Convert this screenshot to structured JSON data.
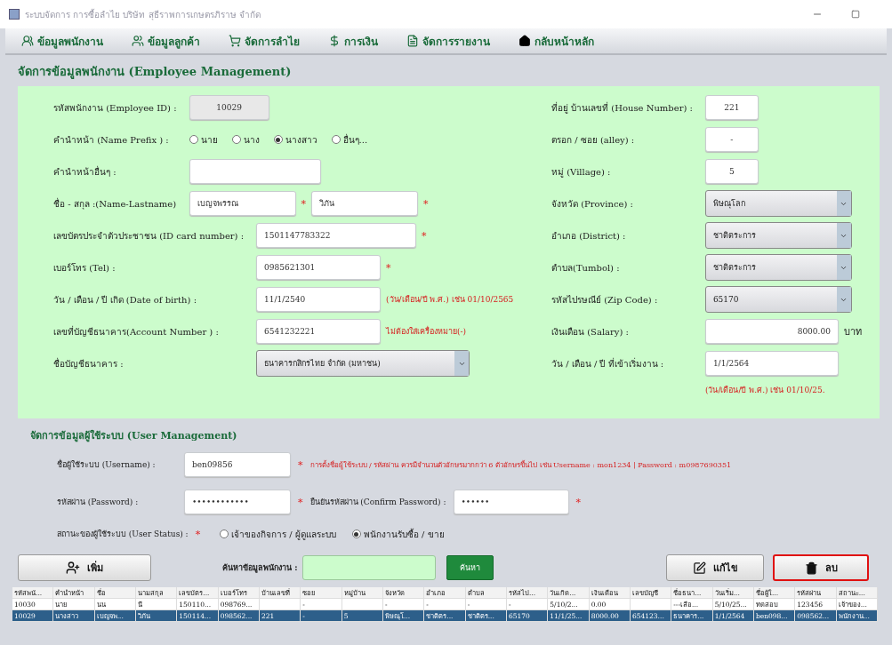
{
  "window": {
    "title": "ระบบจัดการ การซื้อลำไย บริษัท สุธีราพการเกษตรภิราษ จำกัด"
  },
  "menu": [
    {
      "label": "ข้อมูลพนักงาน"
    },
    {
      "label": "ข้อมูลลูกค้า"
    },
    {
      "label": "จัดการลำไย"
    },
    {
      "label": "การเงิน"
    },
    {
      "label": "จัดการรายงาน"
    },
    {
      "label": "กลับหน้าหลัก"
    }
  ],
  "section_title": "จัดการข้อมูลพนักงาน (Employee Management)",
  "employee_left": [
    {
      "kind": "readonly",
      "label": "รหัสพนักงาน (Employee ID) :",
      "value": "10029"
    },
    {
      "kind": "radio",
      "label": "คำนำหน้า (Name Prefix ) :",
      "options": [
        {
          "label": "นาย",
          "selected": false
        },
        {
          "label": "นาง",
          "selected": false
        },
        {
          "label": "นางสาว",
          "selected": true
        },
        {
          "label": "อื่นๆ...",
          "selected": false
        }
      ]
    },
    {
      "kind": "text",
      "label": "คำนำหน้าอื่นๆ  :"
    },
    {
      "kind": "name",
      "label": "ชื่อ - สกุล :(Name-Lastname)",
      "values": [
        "เบญจพรรณ",
        "วิภัน"
      ],
      "marks": [
        "*",
        "*"
      ]
    },
    {
      "kind": "text",
      "label": "เลขบัตรประจำตัวประชาชน (ID card number) :",
      "value": "1501147783322",
      "mark": "*"
    },
    {
      "kind": "text",
      "label": "เบอร์โทร (Tel) :",
      "value": "0985621301",
      "mark": "*"
    },
    {
      "kind": "text",
      "label": "วัน / เดือน / ปี เกิด (Date of birth) :",
      "value": "11/1/2540",
      "note": "(วัน/เดือน/ปี พ.ศ.) เช่น 01/10/2565"
    },
    {
      "kind": "text",
      "label": "เลขที่บัญชีธนาคาร(Account Number ) :",
      "value": "6541232221",
      "note": "ไม่ต้องใส่เครื่องหมาย(-)"
    },
    {
      "kind": "select",
      "label": "ชื่อบัญชีธนาคาร :",
      "value": "ธนาคารกสิกรไทย จำกัด (มหาชน)"
    }
  ],
  "employee_right": [
    {
      "kind": "short",
      "label": "ที่อยู่ บ้านเลขที่ (House Number) :",
      "value": "221"
    },
    {
      "kind": "short",
      "label": "ตรอก / ซอย (alley) :",
      "value": "-"
    },
    {
      "kind": "short",
      "label": "หมู่ (Village) :",
      "value": "5"
    },
    {
      "kind": "select",
      "label": "จังหวัด (Province) :",
      "value": "พิษณุโลก"
    },
    {
      "kind": "select",
      "label": "อำเภอ (District) :",
      "value": "ชาติตระการ"
    },
    {
      "kind": "select",
      "label": "ตำบล(Tumbol) :",
      "value": "ชาติตระการ"
    },
    {
      "kind": "select",
      "label": "รหัสไปรษณีย์ (Zip Code) :",
      "value": "65170"
    },
    {
      "kind": "money",
      "label": "เงินเดือน (Salary) :",
      "value": "8000.00",
      "unit": "บาท"
    },
    {
      "kind": "text",
      "label": "วัน / เดือน / ปี ที่เข้าเริ่มงาน  :",
      "value": "1/1/2564",
      "note": "(วัน/เดือน/ปี พ.ศ.) เช่น 01/10/25."
    }
  ],
  "user_section_title": "จัดการข้อมูลผู้ใช้ระบบ (User Management)",
  "username": {
    "label": "ชื่อผู้ใช้ระบบ (Username) :",
    "value": "ben09856",
    "mark": "*",
    "hint": "การตั้งชื่อผู้ใช้ระบบ / รหัสผ่าน ควรมีจำนวนตัวอักษรมากกว่า 6 ตัวอักษรขึ้นไป เช่น Username : mon1234 | Password : m0987690351"
  },
  "password": {
    "label": "รหัสผ่าน (Password) :",
    "value": "••••••••••••",
    "mark": "*",
    "confirm_label": "ยืนยันรหัสผ่าน (Confirm Password) :",
    "confirm_value": "••••••",
    "confirm_mark": "*"
  },
  "status": {
    "label": "สถานะของผู้ใช้ระบบ (User Status) :",
    "mark": "*",
    "options": [
      {
        "label": "เจ้าของกิจการ / ผู้ดูแลระบบ",
        "selected": false
      },
      {
        "label": "พนักงานรับซื้อ / ขาย",
        "selected": true
      }
    ]
  },
  "actions": {
    "add": "เพิ่ม",
    "search_label": "ค้นหาข้อมูลพนักงาน :",
    "search_button": "ค้นหา",
    "edit": "แก้ไข",
    "delete": "ลบ"
  },
  "table": {
    "columns": [
      "รหัสพนั...",
      "คำนำหน้า",
      "ชื่อ",
      "นามสกุล",
      "เลขบัตร...",
      "เบอร์โทร",
      "บ้านเลขที่",
      "ซอย",
      "หมู่บ้าน",
      "จังหวัด",
      "อำเภอ",
      "ตำบล",
      "รหัสไป...",
      "วันเกิด...",
      "เงินเดือน",
      "เลขบัญชี",
      "ชื่อธนา...",
      "วันเริ่ม...",
      "ชื่อผู้ใ...",
      "รหัสผ่าน",
      "สถานะ..."
    ],
    "rows": [
      {
        "selected": false,
        "cells": [
          "10030",
          "นาย",
          "นน",
          "นี",
          "150110...",
          "098769...",
          "",
          "-",
          "",
          "-",
          "-",
          "-",
          "-",
          "5/10/2...",
          "0.00",
          "",
          "---เลือ...",
          "5/10/25...",
          "ทดสอบ",
          "123456",
          "เจ้าของ..."
        ]
      },
      {
        "selected": true,
        "cells": [
          "10029",
          "นางสาว",
          "เบญจพ...",
          "วิภัน",
          "150114...",
          "098562...",
          "221",
          "-",
          "5",
          "พิษณุโ...",
          "ชาติตร...",
          "ชาติตร...",
          "65170",
          "11/1/25...",
          "8000.00",
          "654123...",
          "ธนาคาร...",
          "1/1/2564",
          "ben098...",
          "098562...",
          "พนักงาน..."
        ]
      }
    ]
  }
}
